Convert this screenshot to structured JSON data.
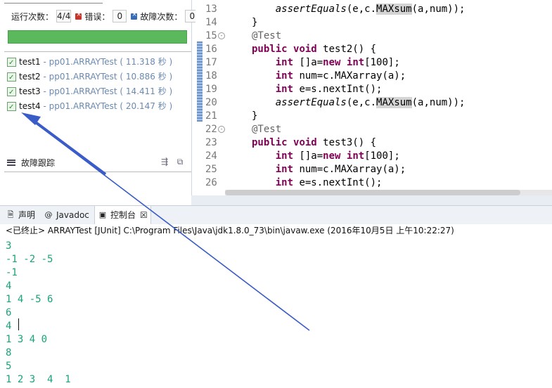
{
  "junit": {
    "counters": {
      "runs_label": "运行次数：",
      "runs_value": "4/4",
      "errors_label": "错误：",
      "errors_value": "0",
      "failures_label": "故障次数：",
      "failures_value": "0"
    },
    "progress_fraction": 1.0,
    "progress_color": "#5cb85c",
    "tests": [
      {
        "name": "test1",
        "sep": " - ",
        "class_time": "pp01.ARRAYTest ( 11.318 秒 )"
      },
      {
        "name": "test2",
        "sep": " - ",
        "class_time": "pp01.ARRAYTest ( 10.886 秒 )"
      },
      {
        "name": "test3",
        "sep": " - ",
        "class_time": "pp01.ARRAYTest ( 14.411 秒 )"
      },
      {
        "name": "test4",
        "sep": " - ",
        "class_time": "pp01.ARRAYTest ( 20.147 秒 )"
      }
    ],
    "trace_label": "故障跟踪"
  },
  "editor": {
    "lines": [
      {
        "n": "13",
        "fold": "",
        "segs": [
          [
            "",
            "    "
          ],
          [
            "it",
            "assertEquals"
          ],
          [
            "",
            "(e,c."
          ],
          [
            "hl",
            "MAXsum"
          ],
          [
            "",
            "(a,num));"
          ]
        ]
      },
      {
        "n": "14",
        "fold": "",
        "segs": [
          [
            "",
            "}"
          ]
        ]
      },
      {
        "n": "15",
        "fold": "⊖",
        "segs": [
          [
            "an",
            "@Test"
          ]
        ]
      },
      {
        "n": "16",
        "fold": "",
        "segs": [
          [
            "kw",
            "public"
          ],
          [
            "",
            " "
          ],
          [
            "kw",
            "void"
          ],
          [
            "",
            " test2() {"
          ]
        ]
      },
      {
        "n": "17",
        "fold": "",
        "segs": [
          [
            "",
            "    "
          ],
          [
            "kw",
            "int"
          ],
          [
            "",
            " []a="
          ],
          [
            "kw",
            "new"
          ],
          [
            "",
            " "
          ],
          [
            "kw",
            "int"
          ],
          [
            "",
            "[100];"
          ]
        ]
      },
      {
        "n": "18",
        "fold": "",
        "segs": [
          [
            "",
            "    "
          ],
          [
            "kw",
            "int"
          ],
          [
            "",
            " num=c.MAXarray(a);"
          ]
        ]
      },
      {
        "n": "19",
        "fold": "",
        "segs": [
          [
            "",
            "    "
          ],
          [
            "kw",
            "int"
          ],
          [
            "",
            " e=s.nextInt();"
          ]
        ]
      },
      {
        "n": "20",
        "fold": "",
        "segs": [
          [
            "",
            "    "
          ],
          [
            "it",
            "assertEquals"
          ],
          [
            "",
            "(e,c."
          ],
          [
            "hl",
            "MAXsum"
          ],
          [
            "",
            "(a,num));"
          ]
        ]
      },
      {
        "n": "21",
        "fold": "",
        "segs": [
          [
            "",
            "}"
          ]
        ]
      },
      {
        "n": "22",
        "fold": "⊖",
        "segs": [
          [
            "an",
            "@Test"
          ]
        ]
      },
      {
        "n": "23",
        "fold": "",
        "segs": [
          [
            "kw",
            "public"
          ],
          [
            "",
            " "
          ],
          [
            "kw",
            "void"
          ],
          [
            "",
            " test3() {"
          ]
        ]
      },
      {
        "n": "24",
        "fold": "",
        "segs": [
          [
            "",
            "    "
          ],
          [
            "kw",
            "int"
          ],
          [
            "",
            " []a="
          ],
          [
            "kw",
            "new"
          ],
          [
            "",
            " "
          ],
          [
            "kw",
            "int"
          ],
          [
            "",
            "[100];"
          ]
        ]
      },
      {
        "n": "25",
        "fold": "",
        "segs": [
          [
            "",
            "    "
          ],
          [
            "kw",
            "int"
          ],
          [
            "",
            " num=c.MAXarray(a);"
          ]
        ]
      },
      {
        "n": "26",
        "fold": "",
        "segs": [
          [
            "",
            "    "
          ],
          [
            "kw",
            "int"
          ],
          [
            "",
            " e=s.nextInt();"
          ]
        ]
      }
    ]
  },
  "console": {
    "tabs": [
      {
        "icon": "declaration-icon",
        "label": "声明"
      },
      {
        "icon": "at-icon",
        "label": "Javadoc"
      },
      {
        "icon": "console-icon",
        "label": "控制台",
        "close": "☒"
      }
    ],
    "status": "<已终止> ARRAYTest [JUnit] C:\\Program Files\\Java\\jdk1.8.0_73\\bin\\javaw.exe (2016年10月5日 上午10:22:27)",
    "output": [
      "3",
      "-1 -2 -5",
      "-1",
      "4",
      "1 4 -5 6",
      "6",
      "4",
      "1 3 4 0",
      "8",
      "5",
      "1 2 3  4  1"
    ]
  },
  "colors": {
    "keyword": "#7f0055",
    "console_text": "#1aa37b",
    "arrow": "#3a5cc8"
  }
}
